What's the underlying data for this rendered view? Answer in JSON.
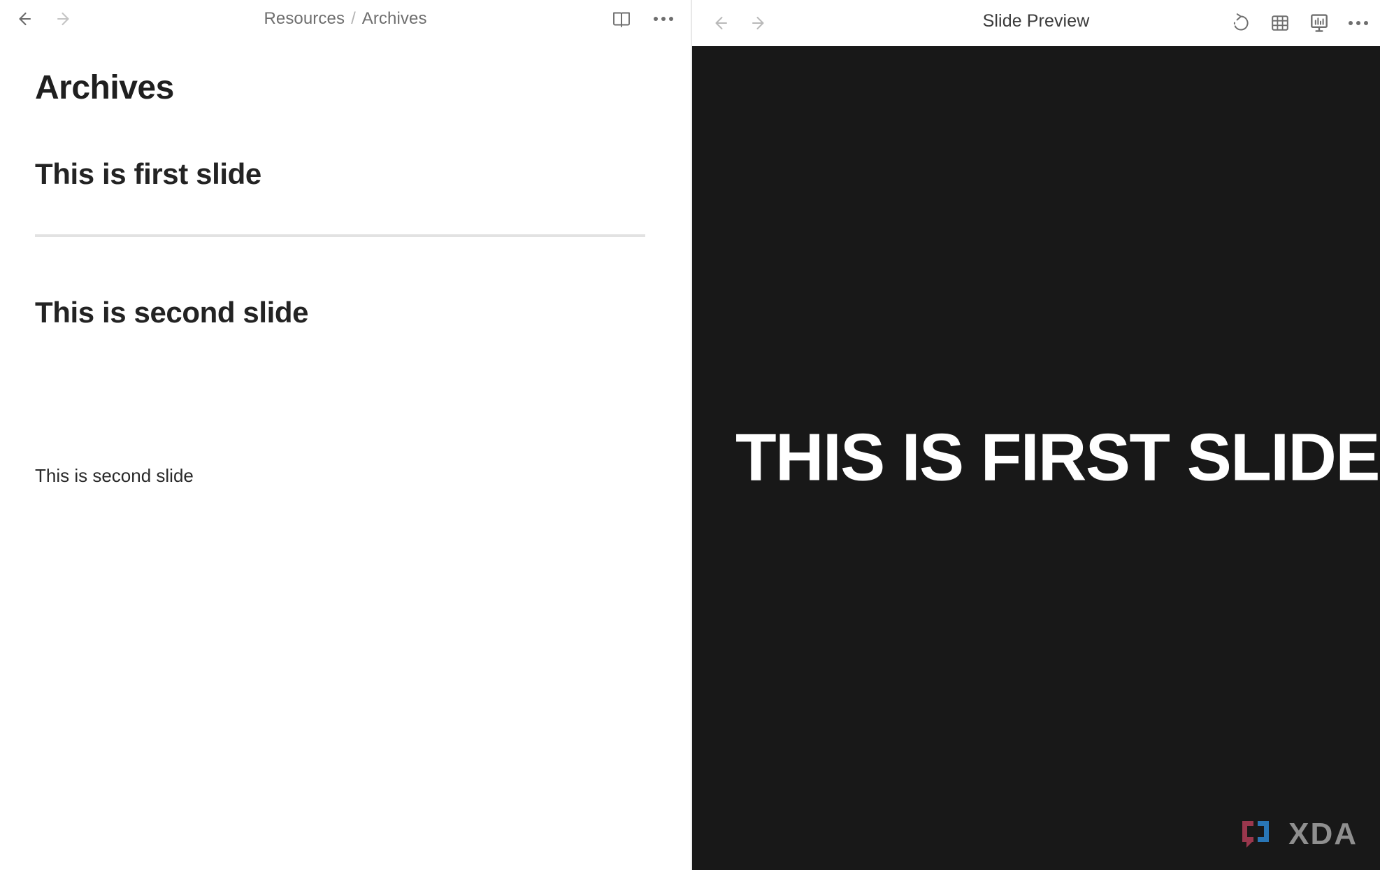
{
  "left_pane": {
    "nav": {
      "back_label": "Back",
      "forward_label": "Forward"
    },
    "breadcrumb": {
      "parent": "Resources",
      "separator": "/",
      "current": "Archives"
    },
    "actions": {
      "reading_mode_label": "Reading mode",
      "more_label": "More options"
    },
    "document": {
      "title": "Archives",
      "blocks": [
        {
          "heading": "This is first slide",
          "has_divider": true
        },
        {
          "heading": "This is second slide",
          "has_divider": false
        }
      ],
      "body_text": "This is second slide"
    }
  },
  "right_pane": {
    "nav": {
      "back_label": "Back",
      "forward_label": "Forward"
    },
    "title": "Slide Preview",
    "actions": {
      "history_label": "Revision history",
      "grid_label": "Slide grid",
      "present_label": "Present slides",
      "more_label": "More options"
    },
    "slide": {
      "headline": "THIS IS FIRST SLIDE",
      "background_color": "#181818",
      "text_color": "#ffffff"
    },
    "watermark": {
      "text": "XDA",
      "mark_left_color": "#a63a52",
      "mark_right_color": "#2b7fc4",
      "text_color": "#9a9a9a"
    }
  }
}
